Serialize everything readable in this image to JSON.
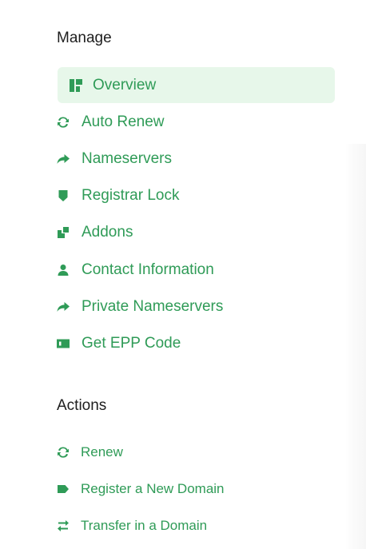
{
  "manage": {
    "title": "Manage",
    "items": [
      {
        "label": "Overview",
        "icon": "dashboard-icon"
      },
      {
        "label": "Auto Renew",
        "icon": "sync-icon"
      },
      {
        "label": "Nameservers",
        "icon": "share-arrow-icon"
      },
      {
        "label": "Registrar Lock",
        "icon": "shield-icon"
      },
      {
        "label": "Addons",
        "icon": "addons-icon"
      },
      {
        "label": "Contact Information",
        "icon": "user-icon"
      },
      {
        "label": "Private Nameservers",
        "icon": "share-arrow-icon"
      },
      {
        "label": "Get EPP Code",
        "icon": "code-card-icon"
      }
    ]
  },
  "actions": {
    "title": "Actions",
    "items": [
      {
        "label": "Renew",
        "icon": "sync-icon"
      },
      {
        "label": "Register a New Domain",
        "icon": "tag-icon"
      },
      {
        "label": "Transfer in a Domain",
        "icon": "transfer-icon"
      }
    ]
  },
  "colors": {
    "accent": "#2f9b57",
    "active_background": "#e7f7ea",
    "heading": "#1e1e1e"
  }
}
